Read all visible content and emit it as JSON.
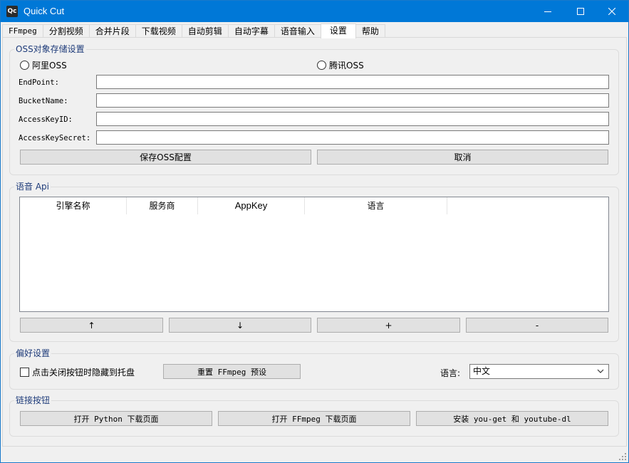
{
  "window": {
    "title": "Quick Cut",
    "icon_text": "Qc",
    "controls": {
      "minimize": "minimize-icon",
      "maximize": "maximize-icon",
      "close": "close-icon"
    }
  },
  "tabs": [
    {
      "label": "FFmpeg"
    },
    {
      "label": "分割视频"
    },
    {
      "label": "合并片段"
    },
    {
      "label": "下载视频"
    },
    {
      "label": "自动剪辑"
    },
    {
      "label": "自动字幕"
    },
    {
      "label": "语音输入"
    },
    {
      "label": "设置",
      "active": true
    },
    {
      "label": "帮助"
    }
  ],
  "oss": {
    "title": "OSS对象存储设置",
    "provider_aliyun": "阿里OSS",
    "provider_tencent": "腾讯OSS",
    "fields": [
      {
        "label": "EndPoint:",
        "value": ""
      },
      {
        "label": "BucketName:",
        "value": ""
      },
      {
        "label": "AccessKeyID:",
        "value": ""
      },
      {
        "label": "AccessKeySecret:",
        "value": ""
      }
    ],
    "save_label": "保存OSS配置",
    "cancel_label": "取消"
  },
  "speech_api": {
    "title": "语音 Api",
    "columns": [
      "引擎名称",
      "服务商",
      "AppKey",
      "语言"
    ],
    "rows": [],
    "buttons": {
      "up": "↑",
      "down": "↓",
      "add": "+",
      "remove": "-"
    }
  },
  "preferences": {
    "title": "偏好设置",
    "hide_to_tray_label": "点击关闭按钮时隐藏到托盘",
    "hide_to_tray_checked": false,
    "reset_label": "重置 FFmpeg 预设",
    "language_label": "语言:",
    "language_value": "中文"
  },
  "links": {
    "title": "链接按钮",
    "python_label": "打开 Python 下载页面",
    "ffmpeg_label": "打开 FFmpeg 下载页面",
    "youget_label": "安装 you-get 和 youtube-dl"
  },
  "colors": {
    "titlebar": "#0078d7",
    "group_title": "#1f3c7a",
    "window_bg": "#f0f0f0"
  }
}
